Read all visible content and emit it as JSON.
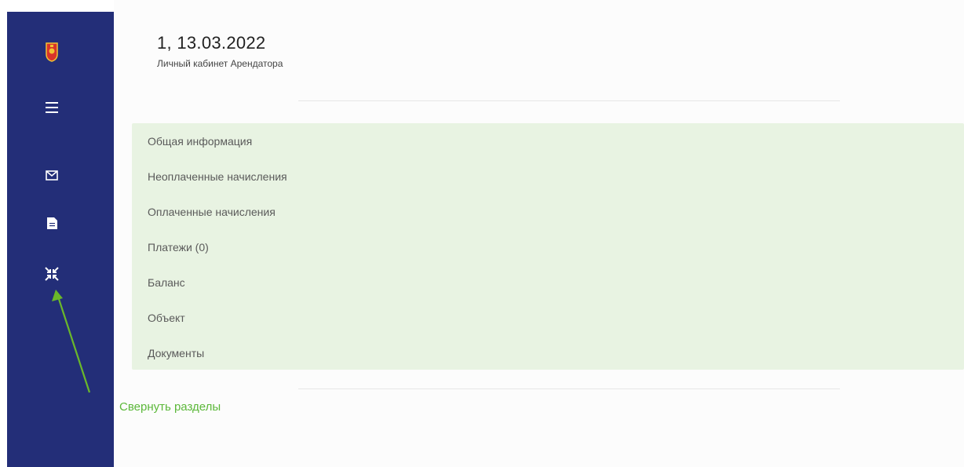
{
  "header": {
    "title": "1, 13.03.2022",
    "subtitle": "Личный кабинет Арендатора"
  },
  "sidebar": {
    "items": [
      {
        "icon": "coat-of-arms-icon"
      },
      {
        "icon": "menu-icon"
      },
      {
        "icon": "mail-icon"
      },
      {
        "icon": "document-icon"
      },
      {
        "icon": "collapse-icon"
      }
    ],
    "background": "#232e78"
  },
  "sections": [
    {
      "label": "Общая информация"
    },
    {
      "label": "Неоплаченные начисления"
    },
    {
      "label": "Оплаченные начисления"
    },
    {
      "label": "Платежи (0)"
    },
    {
      "label": "Баланс"
    },
    {
      "label": "Объект"
    },
    {
      "label": "Документы"
    }
  ],
  "collapse_link": "Свернуть разделы",
  "colors": {
    "panel": "#e8f3e2",
    "accent": "#5cb83a",
    "arrow": "#6ab82a"
  }
}
